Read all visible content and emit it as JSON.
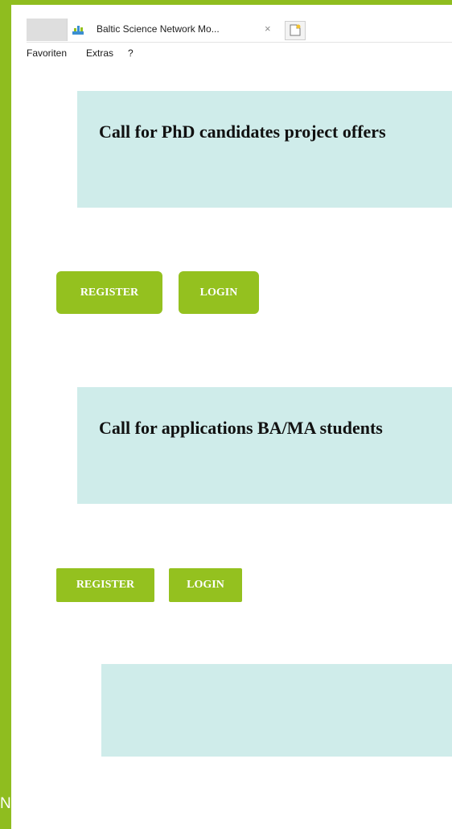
{
  "browser": {
    "tab_title": "Baltic Science Network Mo...",
    "close_glyph": "×",
    "menu": [
      "Favoriten",
      "Extras",
      "?"
    ]
  },
  "sections": [
    {
      "title": "Call for PhD candidates project offers",
      "register_label": "REGISTER",
      "login_label": "LOGIN"
    },
    {
      "title": "Call for applications BA/MA students",
      "register_label": "REGISTER",
      "login_label": "LOGIN"
    },
    {
      "title": ""
    }
  ],
  "colors": {
    "frame_green": "#8fbd1f",
    "button_green": "#94c11f",
    "panel_teal": "#cfecea"
  },
  "icons": {
    "tab_favicon": "site-favicon-icon",
    "tab_close": "close-icon",
    "new_tab": "new-tab-icon"
  }
}
